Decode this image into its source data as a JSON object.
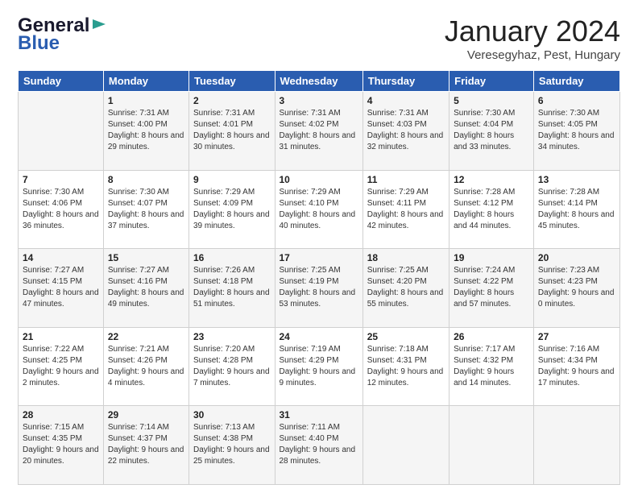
{
  "header": {
    "logo_line1": "General",
    "logo_line2": "Blue",
    "title": "January 2024",
    "subtitle": "Veresegyhaz, Pest, Hungary"
  },
  "days_of_week": [
    "Sunday",
    "Monday",
    "Tuesday",
    "Wednesday",
    "Thursday",
    "Friday",
    "Saturday"
  ],
  "weeks": [
    [
      {
        "day": "",
        "sunrise": "",
        "sunset": "",
        "daylight": ""
      },
      {
        "day": "1",
        "sunrise": "Sunrise: 7:31 AM",
        "sunset": "Sunset: 4:00 PM",
        "daylight": "Daylight: 8 hours and 29 minutes."
      },
      {
        "day": "2",
        "sunrise": "Sunrise: 7:31 AM",
        "sunset": "Sunset: 4:01 PM",
        "daylight": "Daylight: 8 hours and 30 minutes."
      },
      {
        "day": "3",
        "sunrise": "Sunrise: 7:31 AM",
        "sunset": "Sunset: 4:02 PM",
        "daylight": "Daylight: 8 hours and 31 minutes."
      },
      {
        "day": "4",
        "sunrise": "Sunrise: 7:31 AM",
        "sunset": "Sunset: 4:03 PM",
        "daylight": "Daylight: 8 hours and 32 minutes."
      },
      {
        "day": "5",
        "sunrise": "Sunrise: 7:30 AM",
        "sunset": "Sunset: 4:04 PM",
        "daylight": "Daylight: 8 hours and 33 minutes."
      },
      {
        "day": "6",
        "sunrise": "Sunrise: 7:30 AM",
        "sunset": "Sunset: 4:05 PM",
        "daylight": "Daylight: 8 hours and 34 minutes."
      }
    ],
    [
      {
        "day": "7",
        "sunrise": "Sunrise: 7:30 AM",
        "sunset": "Sunset: 4:06 PM",
        "daylight": "Daylight: 8 hours and 36 minutes."
      },
      {
        "day": "8",
        "sunrise": "Sunrise: 7:30 AM",
        "sunset": "Sunset: 4:07 PM",
        "daylight": "Daylight: 8 hours and 37 minutes."
      },
      {
        "day": "9",
        "sunrise": "Sunrise: 7:29 AM",
        "sunset": "Sunset: 4:09 PM",
        "daylight": "Daylight: 8 hours and 39 minutes."
      },
      {
        "day": "10",
        "sunrise": "Sunrise: 7:29 AM",
        "sunset": "Sunset: 4:10 PM",
        "daylight": "Daylight: 8 hours and 40 minutes."
      },
      {
        "day": "11",
        "sunrise": "Sunrise: 7:29 AM",
        "sunset": "Sunset: 4:11 PM",
        "daylight": "Daylight: 8 hours and 42 minutes."
      },
      {
        "day": "12",
        "sunrise": "Sunrise: 7:28 AM",
        "sunset": "Sunset: 4:12 PM",
        "daylight": "Daylight: 8 hours and 44 minutes."
      },
      {
        "day": "13",
        "sunrise": "Sunrise: 7:28 AM",
        "sunset": "Sunset: 4:14 PM",
        "daylight": "Daylight: 8 hours and 45 minutes."
      }
    ],
    [
      {
        "day": "14",
        "sunrise": "Sunrise: 7:27 AM",
        "sunset": "Sunset: 4:15 PM",
        "daylight": "Daylight: 8 hours and 47 minutes."
      },
      {
        "day": "15",
        "sunrise": "Sunrise: 7:27 AM",
        "sunset": "Sunset: 4:16 PM",
        "daylight": "Daylight: 8 hours and 49 minutes."
      },
      {
        "day": "16",
        "sunrise": "Sunrise: 7:26 AM",
        "sunset": "Sunset: 4:18 PM",
        "daylight": "Daylight: 8 hours and 51 minutes."
      },
      {
        "day": "17",
        "sunrise": "Sunrise: 7:25 AM",
        "sunset": "Sunset: 4:19 PM",
        "daylight": "Daylight: 8 hours and 53 minutes."
      },
      {
        "day": "18",
        "sunrise": "Sunrise: 7:25 AM",
        "sunset": "Sunset: 4:20 PM",
        "daylight": "Daylight: 8 hours and 55 minutes."
      },
      {
        "day": "19",
        "sunrise": "Sunrise: 7:24 AM",
        "sunset": "Sunset: 4:22 PM",
        "daylight": "Daylight: 8 hours and 57 minutes."
      },
      {
        "day": "20",
        "sunrise": "Sunrise: 7:23 AM",
        "sunset": "Sunset: 4:23 PM",
        "daylight": "Daylight: 9 hours and 0 minutes."
      }
    ],
    [
      {
        "day": "21",
        "sunrise": "Sunrise: 7:22 AM",
        "sunset": "Sunset: 4:25 PM",
        "daylight": "Daylight: 9 hours and 2 minutes."
      },
      {
        "day": "22",
        "sunrise": "Sunrise: 7:21 AM",
        "sunset": "Sunset: 4:26 PM",
        "daylight": "Daylight: 9 hours and 4 minutes."
      },
      {
        "day": "23",
        "sunrise": "Sunrise: 7:20 AM",
        "sunset": "Sunset: 4:28 PM",
        "daylight": "Daylight: 9 hours and 7 minutes."
      },
      {
        "day": "24",
        "sunrise": "Sunrise: 7:19 AM",
        "sunset": "Sunset: 4:29 PM",
        "daylight": "Daylight: 9 hours and 9 minutes."
      },
      {
        "day": "25",
        "sunrise": "Sunrise: 7:18 AM",
        "sunset": "Sunset: 4:31 PM",
        "daylight": "Daylight: 9 hours and 12 minutes."
      },
      {
        "day": "26",
        "sunrise": "Sunrise: 7:17 AM",
        "sunset": "Sunset: 4:32 PM",
        "daylight": "Daylight: 9 hours and 14 minutes."
      },
      {
        "day": "27",
        "sunrise": "Sunrise: 7:16 AM",
        "sunset": "Sunset: 4:34 PM",
        "daylight": "Daylight: 9 hours and 17 minutes."
      }
    ],
    [
      {
        "day": "28",
        "sunrise": "Sunrise: 7:15 AM",
        "sunset": "Sunset: 4:35 PM",
        "daylight": "Daylight: 9 hours and 20 minutes."
      },
      {
        "day": "29",
        "sunrise": "Sunrise: 7:14 AM",
        "sunset": "Sunset: 4:37 PM",
        "daylight": "Daylight: 9 hours and 22 minutes."
      },
      {
        "day": "30",
        "sunrise": "Sunrise: 7:13 AM",
        "sunset": "Sunset: 4:38 PM",
        "daylight": "Daylight: 9 hours and 25 minutes."
      },
      {
        "day": "31",
        "sunrise": "Sunrise: 7:11 AM",
        "sunset": "Sunset: 4:40 PM",
        "daylight": "Daylight: 9 hours and 28 minutes."
      },
      {
        "day": "",
        "sunrise": "",
        "sunset": "",
        "daylight": ""
      },
      {
        "day": "",
        "sunrise": "",
        "sunset": "",
        "daylight": ""
      },
      {
        "day": "",
        "sunrise": "",
        "sunset": "",
        "daylight": ""
      }
    ]
  ]
}
